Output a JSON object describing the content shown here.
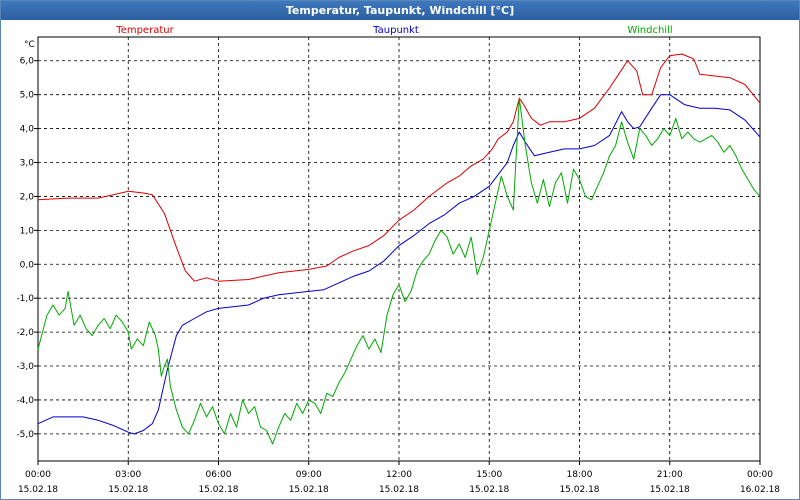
{
  "window": {
    "title": "Temperatur, Taupunkt, Windchill [°C]"
  },
  "chart_data": {
    "type": "line",
    "title": "Temperatur, Taupunkt, Windchill [°C]",
    "ylabel": "°C",
    "xlim": [
      0,
      24
    ],
    "ylim": [
      -5.8,
      6.7
    ],
    "grid": true,
    "legend_position": "top",
    "yticks": [
      -5.0,
      -4.0,
      -3.0,
      -2.0,
      -1.0,
      0.0,
      1.0,
      2.0,
      3.0,
      4.0,
      5.0,
      6.0
    ],
    "ytick_labels": [
      "-5,0",
      "-4,0",
      "-3,0",
      "-2,0",
      "-1,0",
      "0,0",
      "1,0",
      "2,0",
      "3,0",
      "4,0",
      "5,0",
      "6,0"
    ],
    "xticks": [
      {
        "x": 0,
        "time": "00:00",
        "date": "15.02.18"
      },
      {
        "x": 3,
        "time": "03:00",
        "date": "15.02.18"
      },
      {
        "x": 6,
        "time": "06:00",
        "date": "15.02.18"
      },
      {
        "x": 9,
        "time": "09:00",
        "date": "15.02.18"
      },
      {
        "x": 12,
        "time": "12:00",
        "date": "15.02.18"
      },
      {
        "x": 15,
        "time": "15:00",
        "date": "15.02.18"
      },
      {
        "x": 18,
        "time": "18:00",
        "date": "15.02.18"
      },
      {
        "x": 21,
        "time": "21:00",
        "date": "15.02.18"
      },
      {
        "x": 24,
        "time": "00:00",
        "date": "16.02.18"
      }
    ],
    "series": [
      {
        "name": "Temperatur",
        "color": "#dd0000",
        "points": [
          [
            0,
            1.9
          ],
          [
            1,
            1.95
          ],
          [
            2,
            1.95
          ],
          [
            2.5,
            2.05
          ],
          [
            3,
            2.15
          ],
          [
            3.5,
            2.1
          ],
          [
            3.8,
            2.05
          ],
          [
            4.2,
            1.5
          ],
          [
            4.6,
            0.5
          ],
          [
            4.9,
            -0.2
          ],
          [
            5.2,
            -0.5
          ],
          [
            5.6,
            -0.4
          ],
          [
            6,
            -0.5
          ],
          [
            7,
            -0.45
          ],
          [
            8,
            -0.25
          ],
          [
            9,
            -0.15
          ],
          [
            9.6,
            -0.05
          ],
          [
            10,
            0.2
          ],
          [
            10.5,
            0.4
          ],
          [
            11,
            0.55
          ],
          [
            11.5,
            0.85
          ],
          [
            12,
            1.3
          ],
          [
            12.5,
            1.6
          ],
          [
            13,
            2.0
          ],
          [
            13.3,
            2.2
          ],
          [
            13.6,
            2.4
          ],
          [
            14,
            2.6
          ],
          [
            14.4,
            2.9
          ],
          [
            14.8,
            3.1
          ],
          [
            15.1,
            3.4
          ],
          [
            15.3,
            3.7
          ],
          [
            15.6,
            3.9
          ],
          [
            15.8,
            4.2
          ],
          [
            16,
            4.9
          ],
          [
            16.15,
            4.7
          ],
          [
            16.4,
            4.3
          ],
          [
            16.7,
            4.1
          ],
          [
            17,
            4.2
          ],
          [
            17.5,
            4.2
          ],
          [
            18,
            4.3
          ],
          [
            18.5,
            4.6
          ],
          [
            19,
            5.2
          ],
          [
            19.3,
            5.6
          ],
          [
            19.6,
            6.0
          ],
          [
            19.9,
            5.7
          ],
          [
            20.1,
            5.0
          ],
          [
            20.4,
            5.0
          ],
          [
            20.7,
            5.8
          ],
          [
            21,
            6.15
          ],
          [
            21.4,
            6.2
          ],
          [
            21.8,
            6.05
          ],
          [
            22,
            5.6
          ],
          [
            22.5,
            5.55
          ],
          [
            23,
            5.5
          ],
          [
            23.5,
            5.3
          ],
          [
            24,
            4.75
          ]
        ]
      },
      {
        "name": "Taupunkt",
        "color": "#0000cc",
        "points": [
          [
            0,
            -4.7
          ],
          [
            0.5,
            -4.5
          ],
          [
            1,
            -4.5
          ],
          [
            1.5,
            -4.5
          ],
          [
            2,
            -4.6
          ],
          [
            2.5,
            -4.75
          ],
          [
            3,
            -4.95
          ],
          [
            3.2,
            -5.0
          ],
          [
            3.5,
            -4.9
          ],
          [
            3.8,
            -4.7
          ],
          [
            4,
            -4.3
          ],
          [
            4.3,
            -3.1
          ],
          [
            4.6,
            -2.1
          ],
          [
            4.8,
            -1.8
          ],
          [
            5.2,
            -1.6
          ],
          [
            5.6,
            -1.4
          ],
          [
            6,
            -1.3
          ],
          [
            7,
            -1.2
          ],
          [
            7.5,
            -1.0
          ],
          [
            8,
            -0.9
          ],
          [
            9,
            -0.8
          ],
          [
            9.5,
            -0.75
          ],
          [
            10,
            -0.55
          ],
          [
            10.5,
            -0.35
          ],
          [
            11,
            -0.2
          ],
          [
            11.5,
            0.1
          ],
          [
            12,
            0.55
          ],
          [
            12.5,
            0.85
          ],
          [
            13,
            1.2
          ],
          [
            13.5,
            1.45
          ],
          [
            14,
            1.8
          ],
          [
            14.5,
            2.0
          ],
          [
            15,
            2.3
          ],
          [
            15.3,
            2.65
          ],
          [
            15.6,
            3.0
          ],
          [
            15.8,
            3.5
          ],
          [
            16,
            3.9
          ],
          [
            16.2,
            3.6
          ],
          [
            16.5,
            3.2
          ],
          [
            17,
            3.3
          ],
          [
            17.5,
            3.4
          ],
          [
            18,
            3.4
          ],
          [
            18.5,
            3.5
          ],
          [
            19,
            3.8
          ],
          [
            19.4,
            4.5
          ],
          [
            19.6,
            4.2
          ],
          [
            19.8,
            4.0
          ],
          [
            20,
            4.05
          ],
          [
            20.4,
            4.6
          ],
          [
            20.7,
            5.0
          ],
          [
            21,
            5.0
          ],
          [
            21.5,
            4.7
          ],
          [
            22,
            4.6
          ],
          [
            22.5,
            4.6
          ],
          [
            23,
            4.55
          ],
          [
            23.5,
            4.25
          ],
          [
            24,
            3.75
          ]
        ]
      },
      {
        "name": "Windchill",
        "color": "#00aa00",
        "points": [
          [
            0,
            -2.5
          ],
          [
            0.3,
            -1.5
          ],
          [
            0.5,
            -1.2
          ],
          [
            0.7,
            -1.5
          ],
          [
            0.9,
            -1.3
          ],
          [
            1,
            -0.8
          ],
          [
            1.2,
            -1.8
          ],
          [
            1.4,
            -1.5
          ],
          [
            1.6,
            -1.9
          ],
          [
            1.8,
            -2.1
          ],
          [
            2,
            -1.8
          ],
          [
            2.2,
            -1.6
          ],
          [
            2.4,
            -1.9
          ],
          [
            2.6,
            -1.5
          ],
          [
            2.8,
            -1.7
          ],
          [
            3,
            -2.0
          ],
          [
            3.1,
            -2.5
          ],
          [
            3.3,
            -2.2
          ],
          [
            3.5,
            -2.4
          ],
          [
            3.7,
            -1.7
          ],
          [
            3.9,
            -2.1
          ],
          [
            4,
            -2.5
          ],
          [
            4.1,
            -3.3
          ],
          [
            4.2,
            -3.0
          ],
          [
            4.3,
            -2.8
          ],
          [
            4.4,
            -3.6
          ],
          [
            4.6,
            -4.3
          ],
          [
            4.8,
            -4.8
          ],
          [
            5,
            -5.0
          ],
          [
            5.2,
            -4.6
          ],
          [
            5.4,
            -4.1
          ],
          [
            5.6,
            -4.5
          ],
          [
            5.8,
            -4.2
          ],
          [
            6,
            -4.7
          ],
          [
            6.2,
            -5.0
          ],
          [
            6.4,
            -4.4
          ],
          [
            6.6,
            -4.8
          ],
          [
            6.8,
            -4.0
          ],
          [
            7,
            -4.4
          ],
          [
            7.2,
            -4.2
          ],
          [
            7.4,
            -4.8
          ],
          [
            7.6,
            -4.9
          ],
          [
            7.8,
            -5.3
          ],
          [
            8,
            -4.8
          ],
          [
            8.2,
            -4.4
          ],
          [
            8.4,
            -4.6
          ],
          [
            8.6,
            -4.1
          ],
          [
            8.8,
            -4.4
          ],
          [
            9,
            -4.0
          ],
          [
            9.2,
            -4.1
          ],
          [
            9.4,
            -4.4
          ],
          [
            9.6,
            -3.8
          ],
          [
            9.8,
            -3.9
          ],
          [
            10,
            -3.5
          ],
          [
            10.2,
            -3.2
          ],
          [
            10.4,
            -2.8
          ],
          [
            10.6,
            -2.4
          ],
          [
            10.8,
            -2.1
          ],
          [
            11,
            -2.5
          ],
          [
            11.2,
            -2.2
          ],
          [
            11.4,
            -2.6
          ],
          [
            11.6,
            -1.5
          ],
          [
            11.8,
            -0.9
          ],
          [
            12,
            -0.6
          ],
          [
            12.2,
            -1.1
          ],
          [
            12.4,
            -0.8
          ],
          [
            12.6,
            -0.2
          ],
          [
            12.8,
            0.1
          ],
          [
            13,
            0.3
          ],
          [
            13.2,
            0.7
          ],
          [
            13.4,
            1.0
          ],
          [
            13.6,
            0.8
          ],
          [
            13.8,
            0.3
          ],
          [
            14,
            0.6
          ],
          [
            14.2,
            0.2
          ],
          [
            14.4,
            0.8
          ],
          [
            14.6,
            -0.3
          ],
          [
            14.8,
            0.2
          ],
          [
            15,
            1.0
          ],
          [
            15.2,
            1.8
          ],
          [
            15.4,
            2.6
          ],
          [
            15.6,
            2.0
          ],
          [
            15.8,
            1.6
          ],
          [
            16,
            4.9
          ],
          [
            16.2,
            3.5
          ],
          [
            16.4,
            2.4
          ],
          [
            16.6,
            1.8
          ],
          [
            16.8,
            2.5
          ],
          [
            17,
            1.7
          ],
          [
            17.2,
            2.4
          ],
          [
            17.4,
            2.7
          ],
          [
            17.6,
            1.8
          ],
          [
            17.8,
            2.8
          ],
          [
            18,
            2.5
          ],
          [
            18.2,
            2.0
          ],
          [
            18.4,
            1.9
          ],
          [
            18.6,
            2.3
          ],
          [
            18.8,
            2.7
          ],
          [
            19,
            3.2
          ],
          [
            19.2,
            3.5
          ],
          [
            19.4,
            4.2
          ],
          [
            19.6,
            3.6
          ],
          [
            19.8,
            3.1
          ],
          [
            20,
            4.0
          ],
          [
            20.2,
            3.8
          ],
          [
            20.4,
            3.5
          ],
          [
            20.6,
            3.7
          ],
          [
            20.8,
            4.0
          ],
          [
            21,
            3.8
          ],
          [
            21.2,
            4.3
          ],
          [
            21.4,
            3.7
          ],
          [
            21.6,
            3.9
          ],
          [
            21.8,
            3.7
          ],
          [
            22,
            3.6
          ],
          [
            22.2,
            3.7
          ],
          [
            22.4,
            3.8
          ],
          [
            22.6,
            3.6
          ],
          [
            22.8,
            3.3
          ],
          [
            23,
            3.5
          ],
          [
            23.2,
            3.2
          ],
          [
            23.4,
            2.8
          ],
          [
            23.6,
            2.5
          ],
          [
            23.8,
            2.2
          ],
          [
            24,
            2.0
          ]
        ]
      }
    ]
  }
}
